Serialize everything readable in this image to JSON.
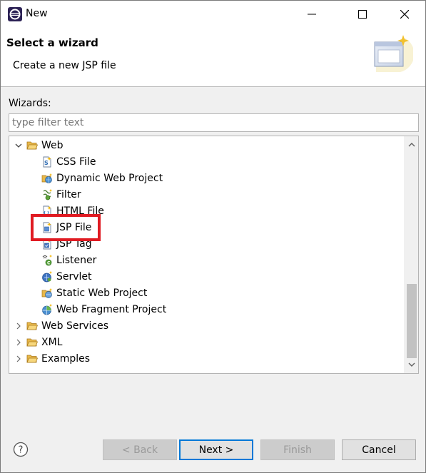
{
  "window": {
    "title": "New"
  },
  "banner": {
    "title": "Select a wizard",
    "description": "Create a new JSP file"
  },
  "filter": {
    "label": "Wizards:",
    "placeholder": "type filter text",
    "value": ""
  },
  "tree": {
    "items": [
      {
        "label": "Web",
        "icon": "folder-open-icon",
        "expanded": true
      },
      {
        "label": "CSS File",
        "icon": "css-file-icon"
      },
      {
        "label": "Dynamic Web Project",
        "icon": "web-project-icon"
      },
      {
        "label": "Filter",
        "icon": "filter-icon"
      },
      {
        "label": "HTML File",
        "icon": "html-file-icon"
      },
      {
        "label": "JSP File",
        "icon": "jsp-file-icon",
        "selected": true
      },
      {
        "label": "JSP Tag",
        "icon": "jsp-tag-icon"
      },
      {
        "label": "Listener",
        "icon": "listener-icon"
      },
      {
        "label": "Servlet",
        "icon": "servlet-icon"
      },
      {
        "label": "Static Web Project",
        "icon": "static-web-project-icon"
      },
      {
        "label": "Web Fragment Project",
        "icon": "web-fragment-project-icon"
      },
      {
        "label": "Web Services",
        "icon": "folder-icon",
        "expanded": false
      },
      {
        "label": "XML",
        "icon": "folder-icon",
        "expanded": false
      },
      {
        "label": "Examples",
        "icon": "folder-icon",
        "expanded": false
      }
    ]
  },
  "buttons": {
    "back": "< Back",
    "next": "Next >",
    "finish": "Finish",
    "cancel": "Cancel"
  },
  "colors": {
    "highlight": "#e01b22",
    "default_button_border": "#0078d7"
  }
}
